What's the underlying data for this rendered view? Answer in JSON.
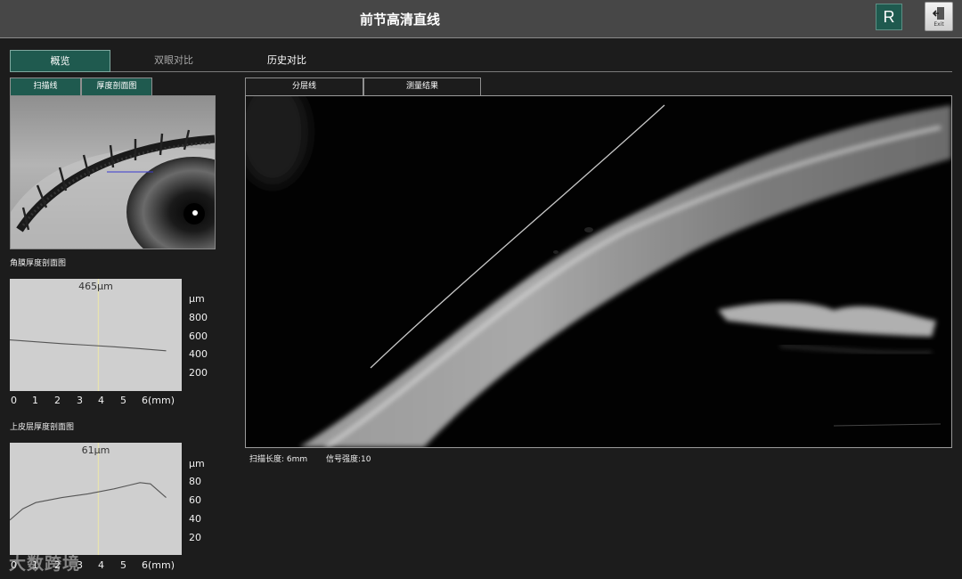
{
  "header": {
    "title": "前节高清直线",
    "eye_badge": "R",
    "exit_label": "Exit"
  },
  "main_tabs": [
    {
      "label": "概览",
      "active": true
    },
    {
      "label": "双眼对比",
      "active": false
    },
    {
      "label": "历史对比",
      "active": false
    }
  ],
  "left_tabs": [
    {
      "label": "扫描线",
      "active": true
    },
    {
      "label": "厚度剖面图",
      "active": true
    }
  ],
  "right_tabs": [
    {
      "label": "分层线",
      "active": false
    },
    {
      "label": "测量结果",
      "active": false
    }
  ],
  "cornea_chart_label": "角膜厚度剖面图",
  "epithelium_chart_label": "上皮层厚度剖面图",
  "chart_data": [
    {
      "type": "line",
      "title": "465μm",
      "ylabel": "μm",
      "xlabel": "(mm)",
      "x_ticks": [
        "0",
        "1",
        "2",
        "3",
        "4",
        "5",
        "6(mm)"
      ],
      "y_ticks": [
        "800",
        "600",
        "400",
        "200"
      ],
      "xlim": [
        0,
        6.6
      ],
      "ylim": [
        100,
        1000
      ],
      "x": [
        0,
        1,
        2,
        3,
        4,
        5,
        6
      ],
      "values": [
        510,
        495,
        480,
        468,
        455,
        440,
        423
      ],
      "marker_x": 3.4
    },
    {
      "type": "line",
      "title": "61μm",
      "ylabel": "μm",
      "xlabel": "(mm)",
      "x_ticks": [
        "0",
        "1",
        "2",
        "3",
        "4",
        "5",
        "6(mm)"
      ],
      "y_ticks": [
        "80",
        "60",
        "40",
        "20"
      ],
      "xlim": [
        0,
        6.6
      ],
      "ylim": [
        10,
        100
      ],
      "x": [
        0,
        0.5,
        1,
        2,
        3,
        4,
        4.6,
        5,
        5.4,
        6
      ],
      "values": [
        38,
        47,
        52,
        56,
        59,
        63,
        66,
        68,
        67,
        56
      ],
      "marker_x": 3.4
    }
  ],
  "status": {
    "scan_length": "扫描长度:  6mm",
    "signal_strength": "信号强度:10"
  },
  "watermark": "大数跨境"
}
